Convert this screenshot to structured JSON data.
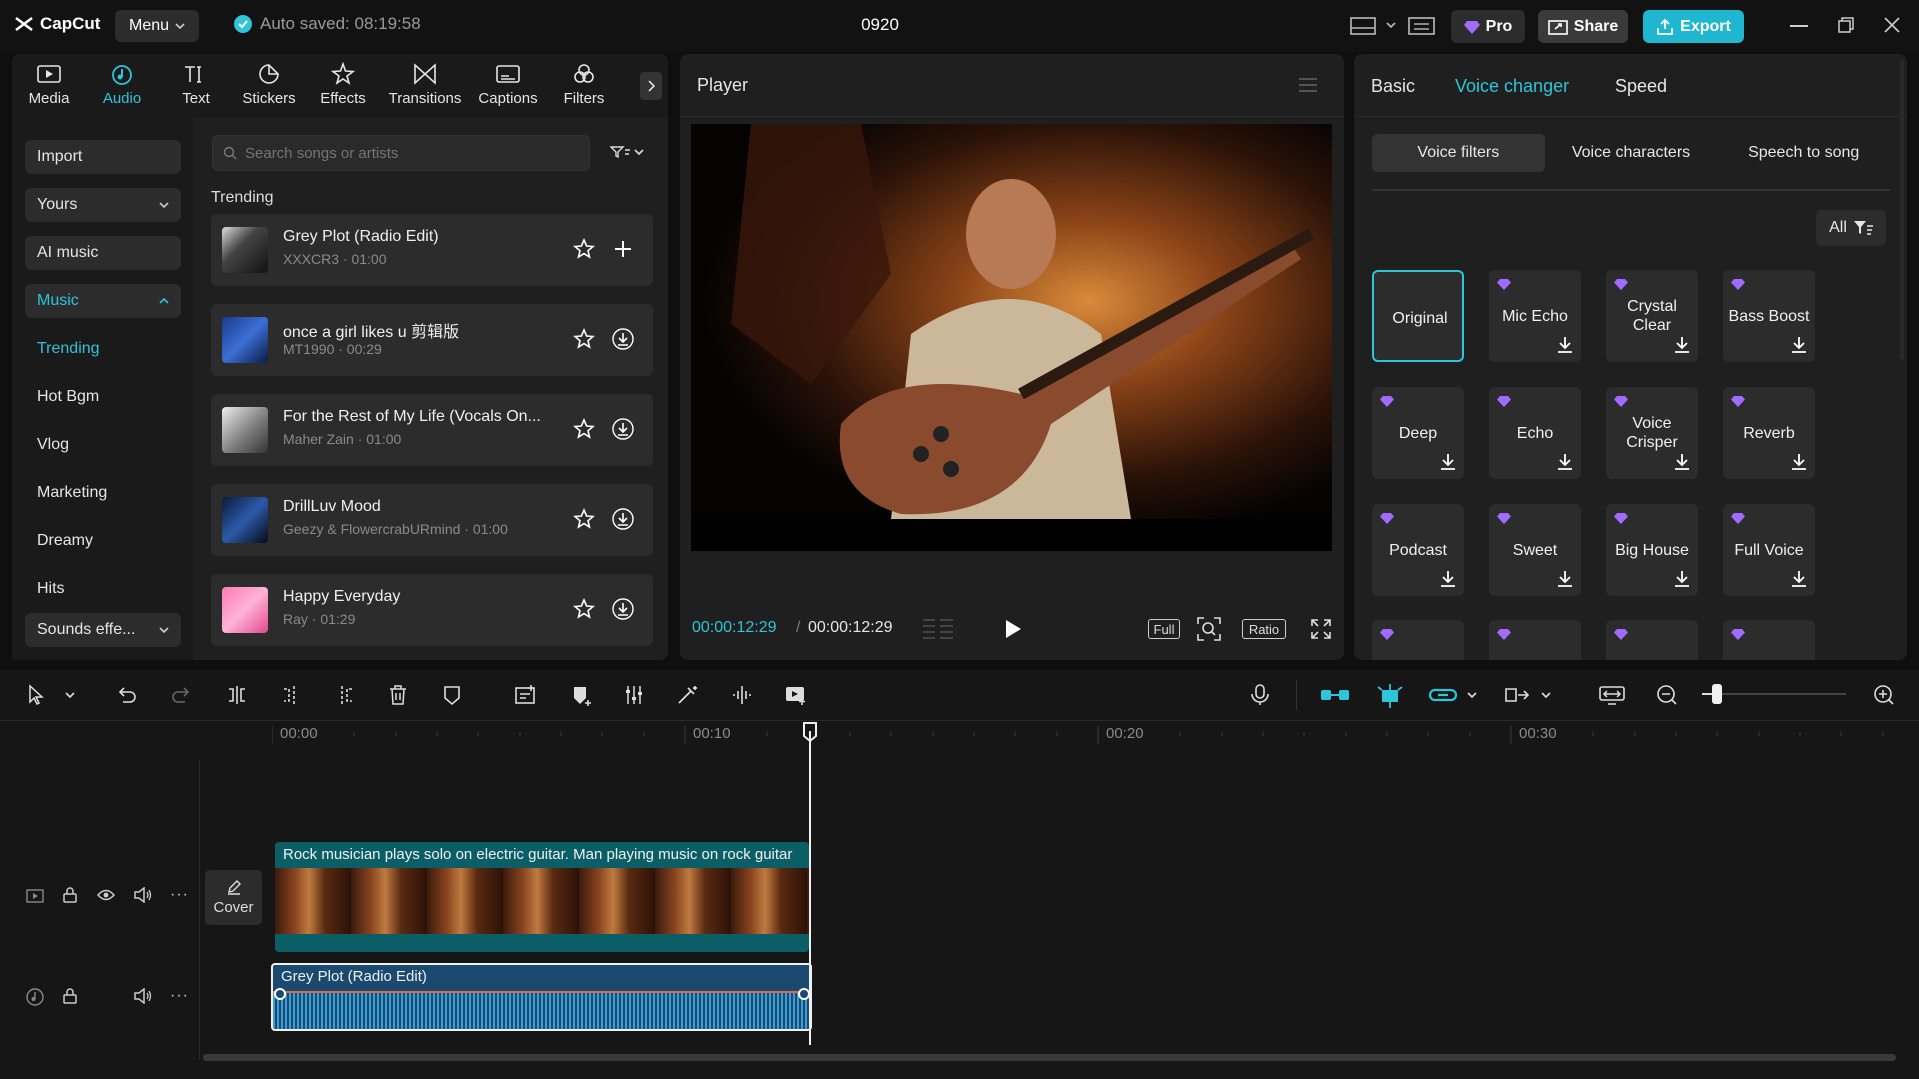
{
  "app": {
    "logo_text": "CapCut",
    "menu_label": "Menu",
    "autosave": "Auto saved: 08:19:58",
    "project_name": "0920",
    "pro_label": "Pro",
    "share_label": "Share",
    "export_label": "Export"
  },
  "colors": {
    "accent": "#2ec4d9",
    "pro": "#a06bff",
    "panel": "#1f1f1f",
    "card": "#2c2c2c"
  },
  "tool_tabs": [
    {
      "label": "Media",
      "icon": "media-icon"
    },
    {
      "label": "Audio",
      "icon": "audio-icon",
      "active": true
    },
    {
      "label": "Text",
      "icon": "text-icon"
    },
    {
      "label": "Stickers",
      "icon": "stickers-icon"
    },
    {
      "label": "Effects",
      "icon": "effects-icon"
    },
    {
      "label": "Transitions",
      "icon": "transitions-icon"
    },
    {
      "label": "Captions",
      "icon": "captions-icon"
    },
    {
      "label": "Filters",
      "icon": "filters-icon"
    }
  ],
  "left_nav": {
    "import": "Import",
    "yours": "Yours",
    "ai_music": "AI music",
    "music": "Music",
    "links": [
      "Trending",
      "Hot Bgm",
      "Vlog",
      "Marketing",
      "Dreamy",
      "Hits"
    ],
    "sounds": "Sounds effe..."
  },
  "search": {
    "placeholder": "Search songs or artists"
  },
  "section_title": "Trending",
  "songs": [
    {
      "title": "Grey Plot (Radio Edit)",
      "sub": "XXXCR3 · 01:00",
      "action": "add"
    },
    {
      "title": "once a girl likes u 剪辑版",
      "sub": "MT1990 · 00:29",
      "action": "download"
    },
    {
      "title": "For the Rest of My Life (Vocals On...",
      "sub": "Maher Zain · 01:00",
      "action": "download"
    },
    {
      "title": "DrillLuv Mood",
      "sub": "Geezy & FlowercrabURmind · 01:00",
      "action": "download"
    },
    {
      "title": "Happy Everyday",
      "sub": "Ray · 01:29",
      "action": "download"
    }
  ],
  "player": {
    "title": "Player",
    "current_time": "00:00:12:29",
    "total_time": "00:00:12:29",
    "full_label": "Full",
    "ratio_label": "Ratio"
  },
  "right": {
    "tabs": [
      "Basic",
      "Voice changer",
      "Speed"
    ],
    "active_tab": "Voice changer",
    "segments": [
      "Voice filters",
      "Voice characters",
      "Speech to song"
    ],
    "filter_all": "All",
    "voices": [
      [
        "Original",
        "Mic Echo",
        "Crystal Clear",
        "Bass Boost"
      ],
      [
        "Deep",
        "Echo",
        "Voice Crisper",
        "Reverb"
      ],
      [
        "Podcast",
        "Sweet",
        "Big House",
        "Full Voice"
      ]
    ]
  },
  "timeline": {
    "ruler": [
      "00:00",
      "00:10",
      "00:20",
      "00:30"
    ],
    "video_caption": "Rock musician plays solo on electric guitar. Man playing music on rock guitar",
    "cover_label": "Cover",
    "audio_clip": "Grey Plot (Radio Edit)"
  }
}
